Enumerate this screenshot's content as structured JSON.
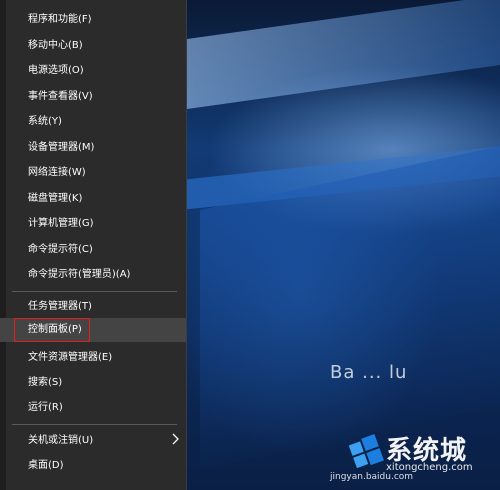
{
  "menu": {
    "items": [
      {
        "label": "程序和功能(F)"
      },
      {
        "label": "移动中心(B)"
      },
      {
        "label": "电源选项(O)"
      },
      {
        "label": "事件查看器(V)"
      },
      {
        "label": "系统(Y)"
      },
      {
        "label": "设备管理器(M)"
      },
      {
        "label": "网络连接(W)"
      },
      {
        "label": "磁盘管理(K)"
      },
      {
        "label": "计算机管理(G)"
      },
      {
        "label": "命令提示符(C)"
      },
      {
        "label": "命令提示符(管理员)(A)"
      },
      {
        "label": "任务管理器(T)"
      },
      {
        "label": "控制面板(P)",
        "highlighted": true
      },
      {
        "label": "文件资源管理器(E)"
      },
      {
        "label": "搜索(S)"
      },
      {
        "label": "运行(R)"
      },
      {
        "label": "关机或注销(U)",
        "has_submenu": true
      },
      {
        "label": "桌面(D)"
      }
    ],
    "highlight_color": "#e02020",
    "background_color": "#2b2b2b"
  },
  "desktop": {
    "partial_text": "Ba ... lu"
  },
  "watermark": {
    "site_name": "系统城",
    "url": "xitongcheng.com",
    "source": "jingyan.baidu.com",
    "logo_icon": "windows-logo-icon"
  }
}
